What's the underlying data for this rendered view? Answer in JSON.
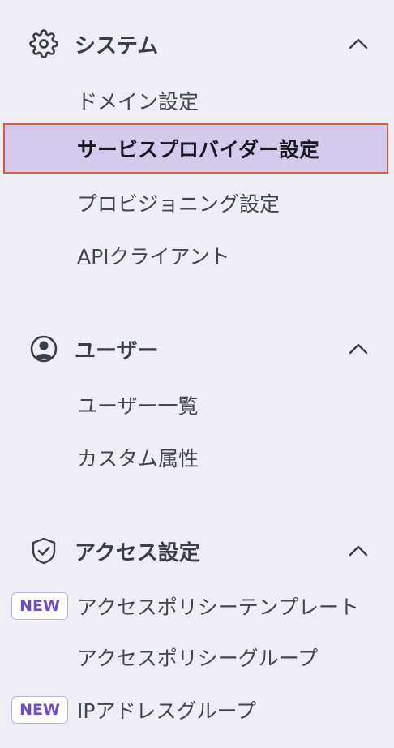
{
  "sections": [
    {
      "title": "システム",
      "icon": "gear-icon",
      "items": [
        {
          "label": "ドメイン設定"
        },
        {
          "label": "サービスプロバイダー設定",
          "selected": true
        },
        {
          "label": "プロビジョニング設定"
        },
        {
          "label": "APIクライアント"
        }
      ]
    },
    {
      "title": "ユーザー",
      "icon": "user-circle-icon",
      "items": [
        {
          "label": "ユーザー一覧"
        },
        {
          "label": "カスタム属性"
        }
      ]
    },
    {
      "title": "アクセス設定",
      "icon": "shield-check-icon",
      "items": [
        {
          "label": "アクセスポリシーテンプレート",
          "badge": "NEW"
        },
        {
          "label": "アクセスポリシーグループ"
        },
        {
          "label": "IPアドレスグループ",
          "badge": "NEW"
        }
      ]
    }
  ],
  "colors": {
    "background": "#efeef5",
    "selected_background": "#d3caec",
    "selected_border": "#e25a3c",
    "badge_text": "#6f47d1"
  }
}
